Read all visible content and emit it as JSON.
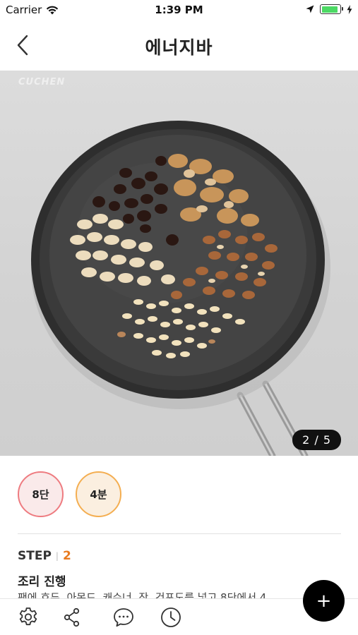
{
  "status_bar": {
    "carrier": "Carrier",
    "time": "1:39 PM",
    "battery_level": 0.9,
    "battery_color": "#4cd964"
  },
  "nav": {
    "title": "에너지바",
    "back_icon": "chevron-left-icon"
  },
  "photo": {
    "watermark": "CUCHEN",
    "page_indicator": "2 / 5",
    "current_page": 2,
    "total_pages": 5
  },
  "info": {
    "heat_level": "8단",
    "cook_time": "4분",
    "heat_color": "#ee7b80",
    "time_color": "#f4ae51"
  },
  "step": {
    "label": "STEP",
    "number": "2",
    "title": "조리 진행",
    "description": "팬에 호두, 아몬드, 캐슈너, 잣, 건포도를 넣고 8단에서 4",
    "number_color": "#e87a1f"
  },
  "tab_bar": {
    "icons": [
      "gear-icon",
      "share-icon",
      "chat-bubble-icon",
      "clock-icon"
    ]
  },
  "fab": {
    "label": "+"
  }
}
